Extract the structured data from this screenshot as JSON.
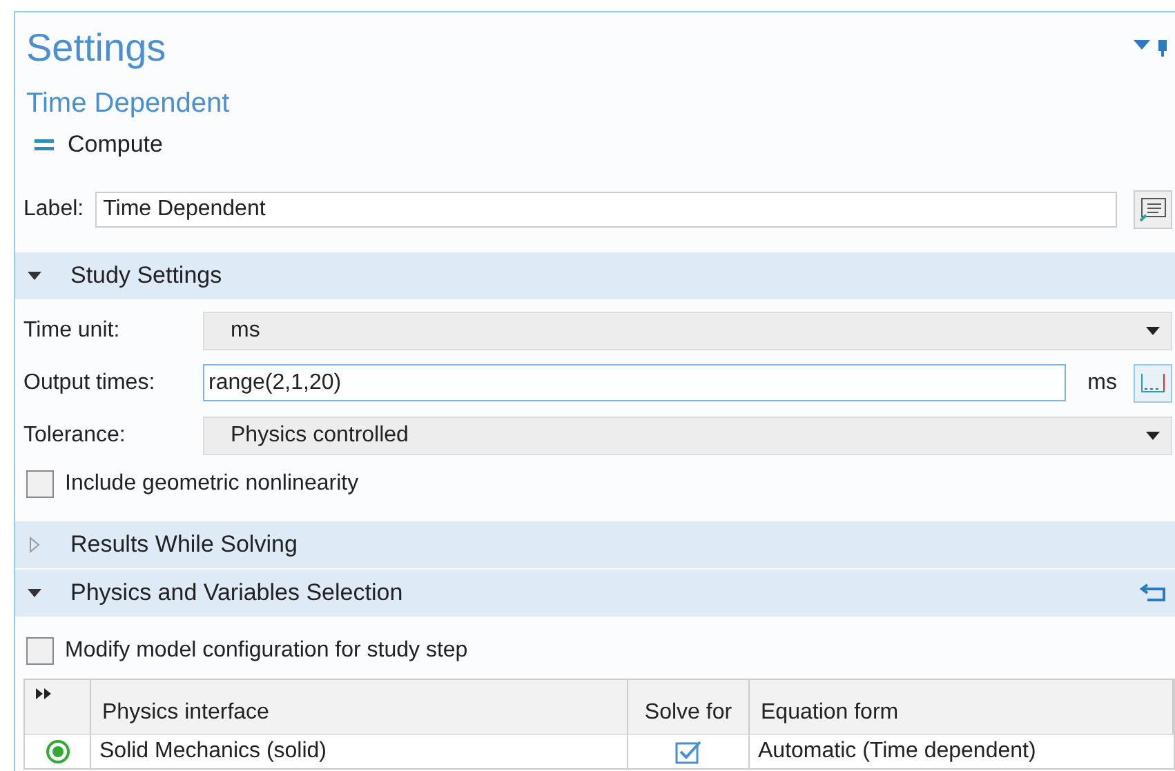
{
  "title": "Settings",
  "subtitle": "Time Dependent",
  "compute": {
    "label": "Compute"
  },
  "label_field": {
    "label": "Label:",
    "value": "Time Dependent"
  },
  "sections": [
    {
      "title": "Study Settings",
      "expanded": true
    },
    {
      "title": "Results While Solving",
      "expanded": false
    },
    {
      "title": "Physics and Variables Selection",
      "expanded": true
    }
  ],
  "study": {
    "time_unit": {
      "label": "Time unit:",
      "value": "ms"
    },
    "output_times": {
      "label": "Output times:",
      "value": "range(2,1,20)",
      "unit": "ms"
    },
    "tolerance": {
      "label": "Tolerance:",
      "value": "Physics controlled"
    },
    "nonlinearity": {
      "label": "Include geometric nonlinearity",
      "checked": false
    }
  },
  "modify": {
    "label": "Modify model configuration for study step",
    "checked": false
  },
  "table": {
    "columns": [
      "Physics interface",
      "Solve for",
      "Equation form"
    ],
    "rows": [
      {
        "interface": "Solid Mechanics (solid)",
        "solve_for": true,
        "equation_form": "Automatic (Time dependent)"
      }
    ]
  }
}
